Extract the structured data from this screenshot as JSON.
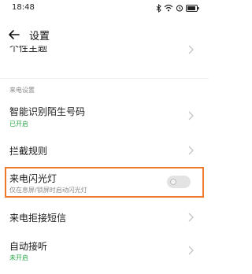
{
  "status_bar": {
    "time": "18:48",
    "icons": [
      "bluetooth-icon",
      "wifi-icon",
      "alarm-icon",
      "battery-icon"
    ]
  },
  "header": {
    "title": "设置",
    "back_icon": "back-arrow-icon"
  },
  "list": {
    "partial_item": {
      "title": "个性主题"
    },
    "section_label": "来电设置",
    "items": [
      {
        "title": "智能识别陌生号码",
        "subtitle": "已开启"
      },
      {
        "title": "拦截规则"
      },
      {
        "title": "来电闪光灯",
        "subtitle": "仅在息屏/锁屏时启动闪光灯",
        "toggle_on": false
      },
      {
        "title": "来电拒接短信"
      },
      {
        "title": "自动接听",
        "subtitle": "未开启"
      }
    ]
  },
  "colors": {
    "highlight_border": "#f07a2c",
    "status_on": "#2aa54a",
    "secondary_text": "#8a8a8a"
  }
}
